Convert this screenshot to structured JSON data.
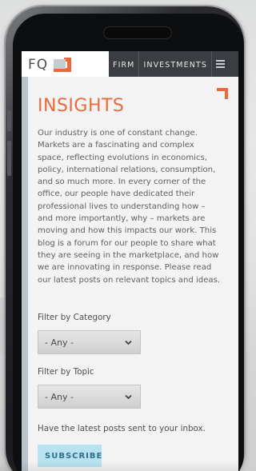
{
  "header": {
    "logo_text": "FQ",
    "nav_items": [
      {
        "label": "FIRM"
      },
      {
        "label": "INVESTMENTS"
      }
    ],
    "menu_icon": "hamburger-menu-icon"
  },
  "main": {
    "title": "INSIGHTS",
    "intro_lines": [
      "Our industry is one of constant change.",
      "Markets are a fascinating and complex",
      "space, reflecting evolutions in economics,",
      "policy, international relations, consumption,",
      "and so much more. In every corner of the",
      "office, our people have dedicated their",
      "professional lives to understanding how –",
      "and more importantly, why – markets are",
      "moving and how this impacts our work. This",
      "blog is a forum for our people to share what",
      "they are seeing in the marketplace, and how",
      "we are innovating in response. Please read",
      "our latest posts on relevant topics and ideas."
    ],
    "filter_category": {
      "label": "Filter by Category",
      "selected": "- Any -"
    },
    "filter_topic": {
      "label": "Filter by Topic",
      "selected": "- Any -"
    },
    "subscribe_prompt": "Have the latest posts sent to your inbox.",
    "subscribe_label": "SUBSCRIBE"
  },
  "colors": {
    "accent": "#ea6a3d",
    "nav_background": "#3a3d41",
    "subscribe_background": "#b8e2ef",
    "subscribe_text": "#2e6f8a"
  }
}
